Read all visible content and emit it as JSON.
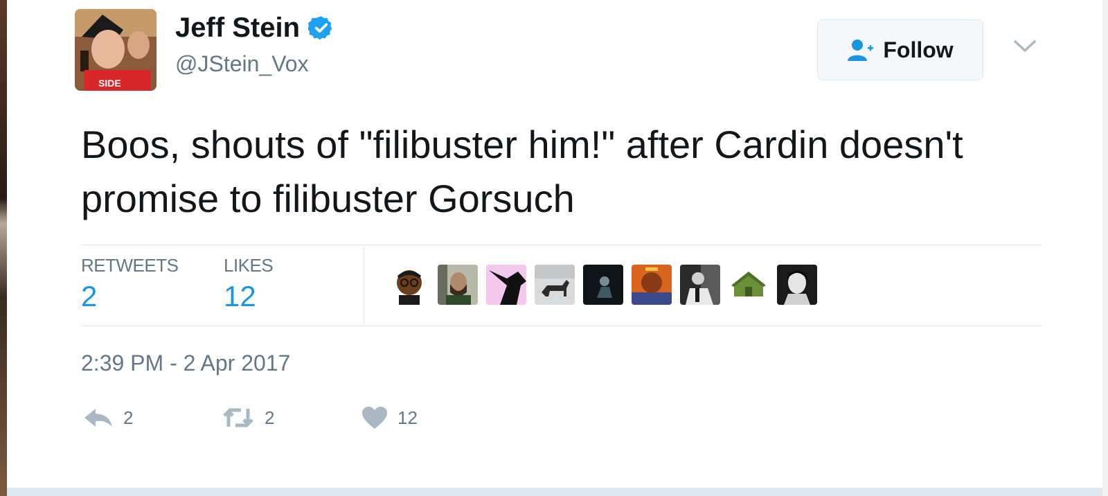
{
  "user": {
    "name": "Jeff Stein",
    "handle": "@JStein_Vox",
    "verified": true,
    "avatar_icon": "profile-photo"
  },
  "follow_button": {
    "label": "Follow",
    "icon": "add-user-icon"
  },
  "menu": {
    "icon": "chevron-down-icon"
  },
  "tweet": {
    "text": "Boos, shouts of \"filibuster him!\" after Cardin doesn't promise to filibuster Gorsuch",
    "timestamp": "2:39 PM - 2 Apr 2017"
  },
  "stats": {
    "retweets_label": "RETWEETS",
    "retweets_count": "2",
    "likes_label": "LIKES",
    "likes_count": "12"
  },
  "liker_avatars": [
    "liker-1",
    "liker-2",
    "liker-3",
    "liker-4",
    "liker-5",
    "liker-6",
    "liker-7",
    "liker-8",
    "liker-9"
  ],
  "actions": {
    "reply_count": "2",
    "retweet_count": "2",
    "like_count": "12"
  },
  "colors": {
    "accent": "#1b95e0",
    "verified": "#1da1f2",
    "text": "#14171a",
    "muted": "#657786",
    "icon": "#aab8c2"
  }
}
